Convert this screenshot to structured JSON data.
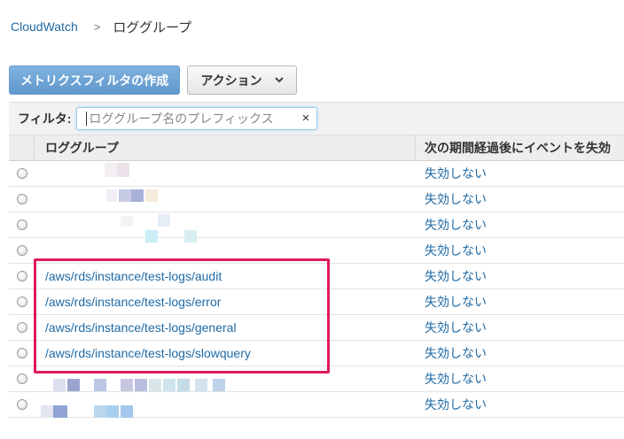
{
  "breadcrumb": {
    "root": "CloudWatch",
    "separator": ">",
    "current": "ロググループ"
  },
  "toolbar": {
    "create_filter_label": "メトリクスフィルタの作成",
    "actions_label": "アクション",
    "chevron_icon": "chevron-down-icon"
  },
  "filter": {
    "label": "フィルタ:",
    "placeholder": "ロググループ名のプレフィックス",
    "clear_icon": "×"
  },
  "table": {
    "columns": [
      "ロググループ",
      "次の期間経過後にイベントを失効"
    ],
    "rows": [
      {
        "name": "",
        "expiry": "失効しない",
        "redacted": true
      },
      {
        "name": "",
        "expiry": "失効しない",
        "redacted": true
      },
      {
        "name": "",
        "expiry": "失効しない",
        "redacted": true
      },
      {
        "name": "",
        "expiry": "失効しない",
        "redacted": true
      },
      {
        "name": "/aws/rds/instance/test-logs/audit",
        "expiry": "失効しない"
      },
      {
        "name": "/aws/rds/instance/test-logs/error",
        "expiry": "失効しない"
      },
      {
        "name": "/aws/rds/instance/test-logs/general",
        "expiry": "失効しない"
      },
      {
        "name": "/aws/rds/instance/test-logs/slowquery",
        "expiry": "失効しない"
      },
      {
        "name": "",
        "expiry": "失効しない",
        "redacted": true
      },
      {
        "name": "",
        "expiry": "失効しない",
        "redacted": true
      }
    ]
  },
  "colors": {
    "link": "#1f6aa5",
    "primary_button": "#6fa6d8",
    "highlight": "#e0195f"
  }
}
